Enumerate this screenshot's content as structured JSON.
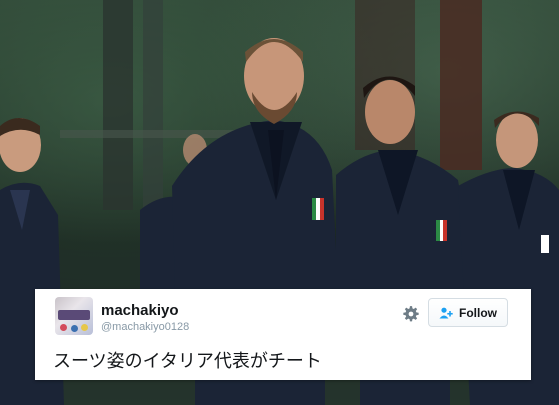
{
  "tweet": {
    "display_name": "machakiyo",
    "handle": "@machakiyo0128",
    "text": "スーツ姿のイタリア代表がチート",
    "follow_label": "Follow",
    "avatar_icon": "user-avatar",
    "settings_icon": "gear-icon",
    "follow_icon": "add-person-icon"
  },
  "colors": {
    "text": "#14171a",
    "secondary_text": "#8899a6",
    "follow_icon_blue": "#1da1f2",
    "suit_navy": "#1b2436"
  }
}
